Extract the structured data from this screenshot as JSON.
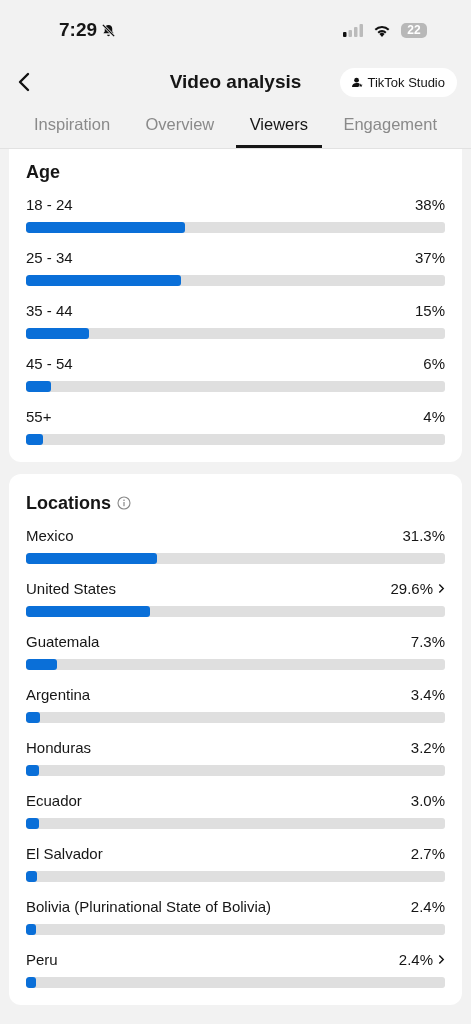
{
  "status_bar": {
    "time": "7:29",
    "silent": true,
    "battery": "22"
  },
  "header": {
    "title": "Video analysis",
    "studio_button": "TikTok Studio"
  },
  "tabs": [
    {
      "label": "Inspiration",
      "selected": false
    },
    {
      "label": "Overview",
      "selected": false
    },
    {
      "label": "Viewers",
      "selected": true
    },
    {
      "label": "Engagement",
      "selected": false
    }
  ],
  "age": {
    "title": "Age",
    "rows": [
      {
        "label": "18 - 24",
        "value": "38%",
        "level": 0.38,
        "detail": false
      },
      {
        "label": "25 - 34",
        "value": "37%",
        "level": 0.37,
        "detail": false
      },
      {
        "label": "35 - 44",
        "value": "15%",
        "level": 0.15,
        "detail": false
      },
      {
        "label": "45 - 54",
        "value": "6%",
        "level": 0.06,
        "detail": false
      },
      {
        "label": "55+",
        "value": "4%",
        "level": 0.04,
        "detail": false
      }
    ]
  },
  "locations": {
    "title": "Locations",
    "rows": [
      {
        "label": "Mexico",
        "value": "31.3%",
        "level": 0.313,
        "detail": false
      },
      {
        "label": "United States",
        "value": "29.6%",
        "level": 0.296,
        "detail": true
      },
      {
        "label": "Guatemala",
        "value": "7.3%",
        "level": 0.073,
        "detail": false
      },
      {
        "label": "Argentina",
        "value": "3.4%",
        "level": 0.034,
        "detail": false
      },
      {
        "label": "Honduras",
        "value": "3.2%",
        "level": 0.032,
        "detail": false
      },
      {
        "label": "Ecuador",
        "value": "3.0%",
        "level": 0.03,
        "detail": false
      },
      {
        "label": "El Salvador",
        "value": "2.7%",
        "level": 0.027,
        "detail": false
      },
      {
        "label": "Bolivia (Plurinational State of Bolivia)",
        "value": "2.4%",
        "level": 0.024,
        "detail": false
      },
      {
        "label": "Peru",
        "value": "2.4%",
        "level": 0.024,
        "detail": true
      }
    ]
  }
}
